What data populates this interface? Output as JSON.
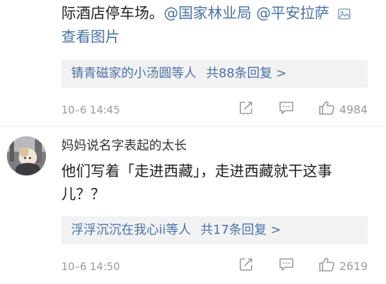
{
  "comment1": {
    "line1_text": "际酒店停车场。",
    "mention1": "@国家林业局",
    "mention2": "@平安拉萨",
    "view_pic": "查看图片",
    "replies_summary": "锖青磁家的小汤圆等人",
    "replies_count": "共88条回复 >",
    "timestamp": "10–6 14:45",
    "likes": "4984"
  },
  "comment2": {
    "username": "妈妈说名字表起的太长",
    "text_line1": "他们写着「走进西藏」，走进西藏就干这事",
    "text_line2": "儿？？",
    "replies_summary": "浮浮沉沉在我心ii等人",
    "replies_count": "共17条回复 >",
    "timestamp": "10–6 14:50",
    "likes": "2619"
  },
  "icons": [
    "picture-icon",
    "share-icon",
    "comment-icon",
    "like-icon"
  ]
}
